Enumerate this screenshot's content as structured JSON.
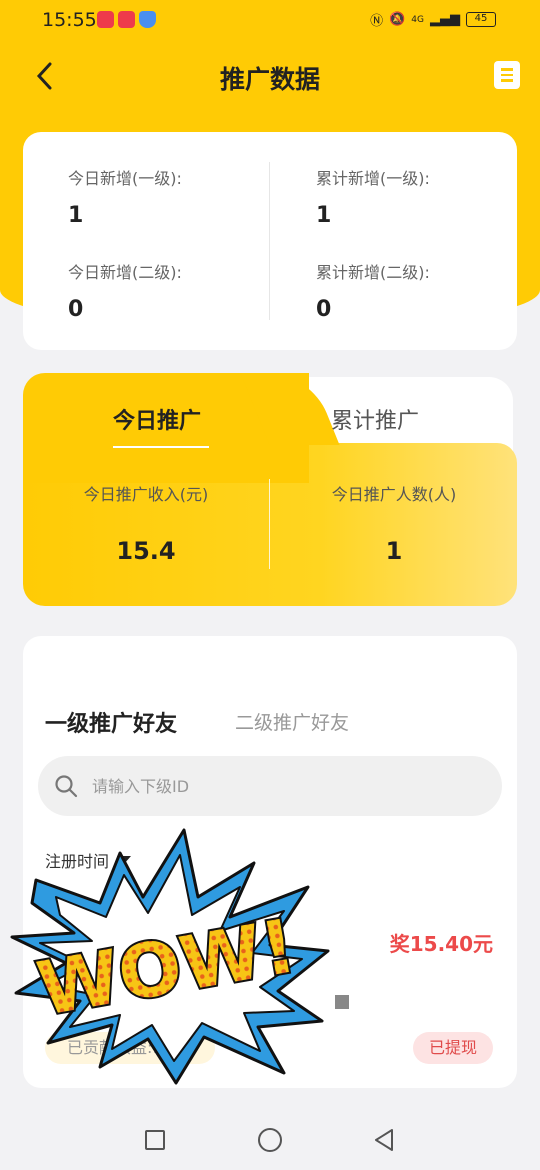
{
  "status_bar": {
    "time": "15:55",
    "network": "4G",
    "battery": "45"
  },
  "header": {
    "title": "推广数据"
  },
  "stats": {
    "today_level1_label": "今日新增(一级):",
    "today_level1_value": "1",
    "total_level1_label": "累计新增(一级):",
    "total_level1_value": "1",
    "today_level2_label": "今日新增(二级):",
    "today_level2_value": "0",
    "total_level2_label": "累计新增(二级):",
    "total_level2_value": "0"
  },
  "promo": {
    "tabs": [
      "今日推广",
      "累计推广"
    ],
    "income_label": "今日推广收入(元)",
    "income_value": "15.4",
    "people_label": "今日推广人数(人)",
    "people_value": "1"
  },
  "friends": {
    "tabs": [
      "一级推广好友",
      "二级推广好友"
    ],
    "search_placeholder": "请输入下级ID",
    "sort_label": "注册时间",
    "reward": "奖15.40元",
    "contribution": "已贡献收益:15",
    "status": "已提现"
  },
  "sticker": {
    "text": "WOW!"
  },
  "colors": {
    "accent": "#ffcb05",
    "reward": "#ec4a4a",
    "sticker_blue": "#3aa0e8"
  }
}
